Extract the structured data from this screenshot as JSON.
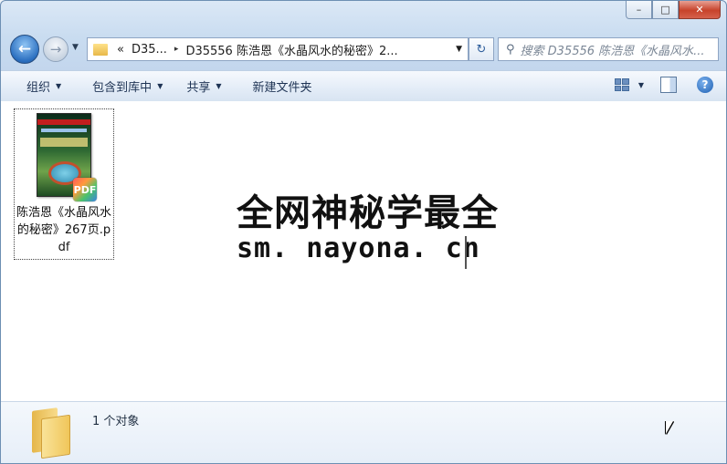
{
  "window": {
    "caption": {
      "minimize_glyph": "–",
      "maximize_glyph": "□",
      "close_glyph": "✕"
    }
  },
  "nav": {
    "back_glyph": "←",
    "forward_glyph": "→",
    "dropdown_glyph": "▼"
  },
  "address": {
    "chevrons": "«",
    "crumb_1": "D35...",
    "crumb_2": "D35556 陈浩恩《水晶风水的秘密》2...",
    "separator": "▸",
    "dropdown_glyph": "▼"
  },
  "refresh": {
    "glyph": "↻"
  },
  "search": {
    "icon_glyph": "⚲",
    "placeholder": "搜索 D35556 陈浩恩《水晶风水..."
  },
  "toolbar": {
    "organize": "组织",
    "include_in_library": "包含到库中",
    "share": "共享",
    "new_folder": "新建文件夹",
    "caret": "▼",
    "help_glyph": "?"
  },
  "files": [
    {
      "name": "陈浩恩《水晶风水的秘密》267页.pdf",
      "badge": "PDF"
    }
  ],
  "watermark": {
    "line1": "全网神秘学最全",
    "line2": "sm. nayona. cn"
  },
  "status": {
    "item_count": "1 个对象"
  },
  "colors": {
    "accent": "#2b6fc0",
    "close_button": "#c7432b",
    "window_border": "#6d8fb3"
  }
}
